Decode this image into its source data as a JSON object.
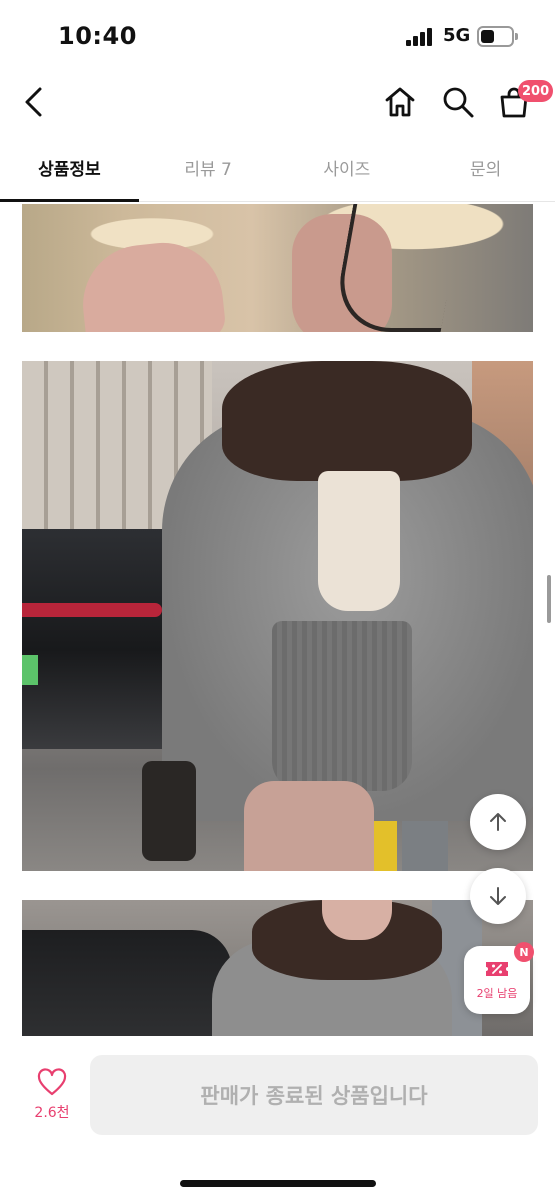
{
  "status_bar": {
    "time": "10:40",
    "network": "5G"
  },
  "header": {
    "icons": [
      "back-icon",
      "home-icon",
      "search-icon",
      "shopping-bag-icon"
    ],
    "cart_badge": "200",
    "accent_color": "#f0506e"
  },
  "tabs": [
    {
      "label": "상품정보",
      "active": true
    },
    {
      "label": "리뷰 7",
      "active": false
    },
    {
      "label": "사이즈",
      "active": false
    },
    {
      "label": "문의",
      "active": false
    }
  ],
  "floating": {
    "coupon_label": "2일 남음",
    "coupon_badge": "N"
  },
  "bottom_bar": {
    "like_count": "2.6천",
    "purchase_button": "판매가 종료된 상품입니다"
  }
}
